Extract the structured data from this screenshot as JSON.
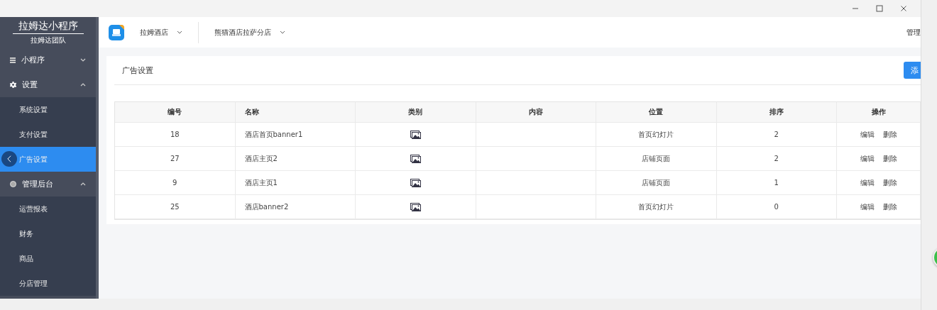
{
  "sidebar": {
    "title": "拉姆达小程序",
    "subtitle": "拉姆达团队",
    "groups": [
      {
        "label": "小程序",
        "expanded": false
      },
      {
        "label": "设置",
        "expanded": true,
        "children": [
          {
            "label": "系统设置",
            "selected": false
          },
          {
            "label": "支付设置",
            "selected": false
          },
          {
            "label": "广告设置",
            "selected": true
          }
        ]
      },
      {
        "label": "管理后台",
        "expanded": true,
        "children": [
          {
            "label": "运营报表",
            "selected": false
          },
          {
            "label": "财务",
            "selected": false
          },
          {
            "label": "商品",
            "selected": false
          },
          {
            "label": "分店管理",
            "selected": false
          }
        ]
      }
    ]
  },
  "header": {
    "selects": [
      {
        "value": "拉姆酒店"
      },
      {
        "value": "熊猫酒店拉萨分店"
      }
    ],
    "user": "管理"
  },
  "card": {
    "title": "广告设置",
    "add_button": "添"
  },
  "table": {
    "columns": [
      "编号",
      "名称",
      "类别",
      "内容",
      "位置",
      "排序",
      "操作"
    ],
    "rows": [
      {
        "id": "18",
        "name": "酒店首页banner1",
        "position": "首页幻灯片",
        "sort": "2",
        "actions": [
          "编辑",
          "删除"
        ]
      },
      {
        "id": "27",
        "name": "酒店主页2",
        "position": "店铺页面",
        "sort": "2",
        "actions": [
          "编辑",
          "删除"
        ]
      },
      {
        "id": "9",
        "name": "酒店主页1",
        "position": "店铺页面",
        "sort": "1",
        "actions": [
          "编辑",
          "删除"
        ]
      },
      {
        "id": "25",
        "name": "酒店banner2",
        "position": "首页幻灯片",
        "sort": "0",
        "actions": [
          "编辑",
          "删除"
        ]
      }
    ]
  }
}
